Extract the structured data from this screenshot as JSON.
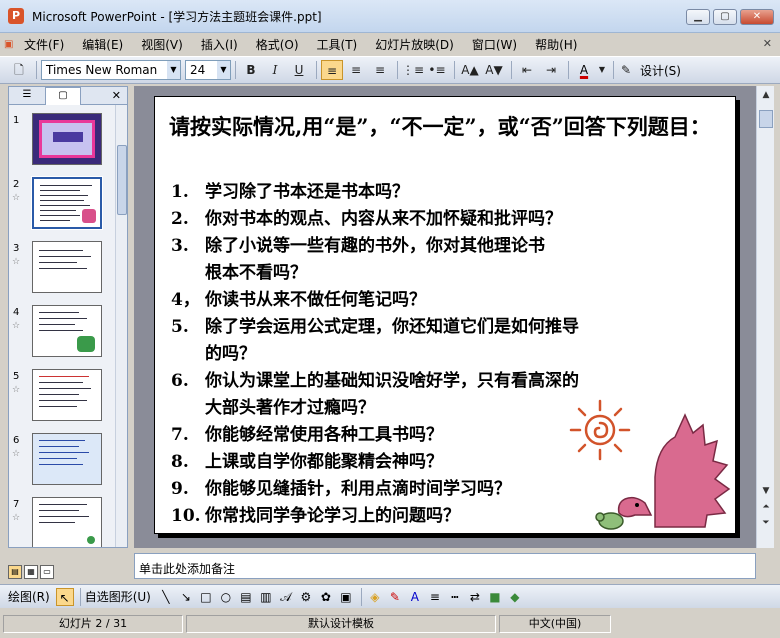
{
  "window": {
    "title": "Microsoft PowerPoint - [学习方法主题班会课件.ppt]",
    "app_icon": "P"
  },
  "menu": [
    "文件(F)",
    "编辑(E)",
    "视图(V)",
    "插入(I)",
    "格式(O)",
    "工具(T)",
    "幻灯片放映(D)",
    "窗口(W)",
    "帮助(H)"
  ],
  "toolbar": {
    "font": "Times New Roman",
    "size": "24",
    "design_label": "设计(S)",
    "bold": "B",
    "italic": "I",
    "underline": "U"
  },
  "thumbnails": [
    {
      "num": "1",
      "star": ""
    },
    {
      "num": "2",
      "star": "☆"
    },
    {
      "num": "3",
      "star": "☆"
    },
    {
      "num": "4",
      "star": "☆"
    },
    {
      "num": "5",
      "star": "☆"
    },
    {
      "num": "6",
      "star": "☆"
    },
    {
      "num": "7",
      "star": "☆"
    }
  ],
  "slide": {
    "title": "请按实际情况,用“是”，“不一定”，或“否”回答下列题目：",
    "questions": [
      {
        "n": "1.",
        "text": "学习除了书本还是书本吗？",
        "cont": ""
      },
      {
        "n": "2.",
        "text": "你对书本的观点、内容从来不加怀疑和批评吗？",
        "cont": ""
      },
      {
        "n": "3.",
        "text": "除了小说等一些有趣的书外，你对其他理论书",
        "cont": "根本不看吗？"
      },
      {
        "n": "4，",
        "text": "你读书从来不做任何笔记吗？",
        "cont": ""
      },
      {
        "n": "5.",
        "text": "除了学会运用公式定理，你还知道它们是如何推导",
        "cont": "的吗？"
      },
      {
        "n": "6.",
        "text": "你认为课堂上的基础知识没啥好学，只有看高深的",
        "cont": "大部头著作才过瘾吗？"
      },
      {
        "n": "7.",
        "text": "你能够经常使用各种工具书吗？",
        "cont": ""
      },
      {
        "n": "8.",
        "text": "上课或自学你都能聚精会神吗？",
        "cont": ""
      },
      {
        "n": "9.",
        "text": "你能够见缝插针，利用点滴时间学习吗？",
        "cont": ""
      },
      {
        "n": "10.",
        "text": "你常找同学争论学习上的问题吗？",
        "cont": ""
      }
    ]
  },
  "notes": {
    "placeholder": "单击此处添加备注"
  },
  "drawbar": {
    "draw_label": "绘图(R)",
    "autoshape_label": "自选图形(U)"
  },
  "status": {
    "slide": "幻灯片 2 / 31",
    "design": "默认设计模板",
    "lang": "中文(中国)"
  }
}
